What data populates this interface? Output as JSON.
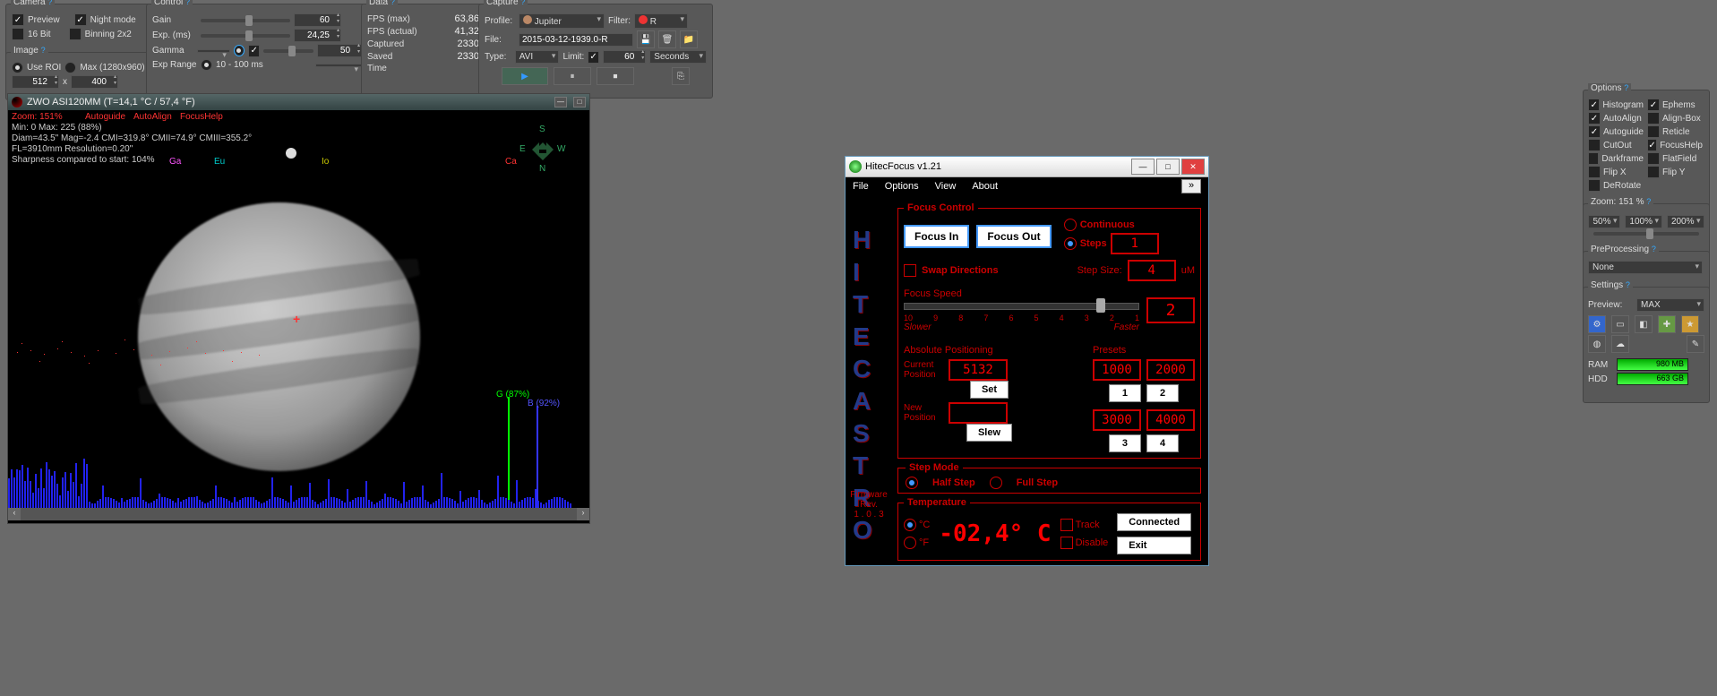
{
  "camera": {
    "title": "Camera",
    "preview": "Preview",
    "night": "Night mode",
    "bit16": "16 Bit",
    "binning": "Binning 2x2"
  },
  "image": {
    "title": "Image",
    "useroi": "Use ROI",
    "max": "Max (1280x960)",
    "w": "512",
    "x": "x",
    "h": "400"
  },
  "control": {
    "title": "Control",
    "gain": "Gain",
    "gainv": "60",
    "exp": "Exp. (ms)",
    "expv": "24,25",
    "gamma": "Gamma",
    "gammav": "50",
    "exprange": "Exp Range",
    "exprangev": "10 - 100 ms"
  },
  "data": {
    "title": "Data",
    "fpsmax": "FPS (max)",
    "fpsmaxv": "63,86",
    "fpsact": "FPS (actual)",
    "fpsactv": "41,32",
    "captured": "Captured",
    "capturedv": "2330",
    "saved": "Saved",
    "savedv": "2330",
    "time": "Time"
  },
  "capture": {
    "title": "Capture",
    "profile": "Profile:",
    "profilev": "Jupiter",
    "filter": "Filter:",
    "filterv": "R",
    "file": "File:",
    "filev": "2015-03-12-1939.0-R",
    "type": "Type:",
    "typev": "AVI",
    "limit": "Limit:",
    "limitv": "60",
    "limitunit": "Seconds"
  },
  "camwin": {
    "title": "ZWO ASI120MM   (T=14,1 °C / 57,4 °F)",
    "zoom": "Zoom: 151%",
    "autoguide": "Autoguide",
    "autoalign": "AutoAlign",
    "focushelp": "FocusHelp",
    "minmax": "Min: 0     Max: 225  (88%)",
    "diam": "Diam=43.5\"   Mag=-2.4   CMI=319.8° CMII=74.9° CMIII=355.2°",
    "fl": "FL=3910mm   Resolution=0.20\"",
    "sharp": "Sharpness compared to start: 104%",
    "ga": "Ga",
    "eu": "Eu",
    "io": "Io",
    "ca": "Ca",
    "g": "G (87%)",
    "b": "B (92%)",
    "compass": {
      "n": "N",
      "s": "S",
      "e": "E",
      "w": "W"
    }
  },
  "hf": {
    "title": "HitecFocus v1.21",
    "menu": {
      "file": "File",
      "options": "Options",
      "view": "View",
      "about": "About"
    },
    "focus_control": "Focus Control",
    "focusin": "Focus In",
    "focusout": "Focus Out",
    "continuous": "Continuous",
    "steps": "Steps",
    "stepsv": "1",
    "swap": "Swap Directions",
    "stepsize": "Step Size:",
    "stepsizev": "4",
    "um": "uM",
    "focusspeed": "Focus Speed",
    "speedv": "2",
    "slower": "Slower",
    "faster": "Faster",
    "ticks": [
      "10",
      "9",
      "8",
      "7",
      "6",
      "5",
      "4",
      "3",
      "2",
      "1"
    ],
    "abspos": "Absolute Positioning",
    "presets": "Presets",
    "curpos": "Current Position",
    "curposv": "5132",
    "set": "Set",
    "newpos": "New Position",
    "slew": "Slew",
    "p1": "1000",
    "p2": "2000",
    "p3": "3000",
    "p4": "4000",
    "b1": "1",
    "b2": "2",
    "b3": "3",
    "b4": "4",
    "stepmode": "Step Mode",
    "half": "Half Step",
    "full": "Full Step",
    "temperature": "Temperature",
    "c": "°C",
    "f": "°F",
    "tempv": "-02,4° C",
    "track": "Track",
    "disable": "Disable",
    "connected": "Connected",
    "exit": "Exit",
    "fw": "Firmware Rev.",
    "fwv": "1 . 0 . 3",
    "logo": [
      "H",
      "I",
      "T",
      "E",
      "C",
      "A",
      "S",
      "T",
      "R",
      "O"
    ]
  },
  "options": {
    "title": "Options",
    "hist": "Histogram",
    "eph": "Ephems",
    "aa": "AutoAlign",
    "ab": "Align-Box",
    "ag": "Autoguide",
    "ret": "Reticle",
    "co": "CutOut",
    "fh": "FocusHelp",
    "df": "Darkframe",
    "ff": "FlatField",
    "fx": "Flip X",
    "fy": "Flip Y",
    "dr": "DeRotate"
  },
  "zoom": {
    "title": "Zoom: 151 %",
    "z50": "50%",
    "z100": "100%",
    "z200": "200%"
  },
  "prep": {
    "title": "PreProcessing",
    "v": "None"
  },
  "settings": {
    "title": "Settings",
    "preview": "Preview:",
    "previewv": "MAX",
    "ram": "RAM",
    "ramv": "980 MB",
    "hdd": "HDD",
    "hddv": "663 GB"
  }
}
